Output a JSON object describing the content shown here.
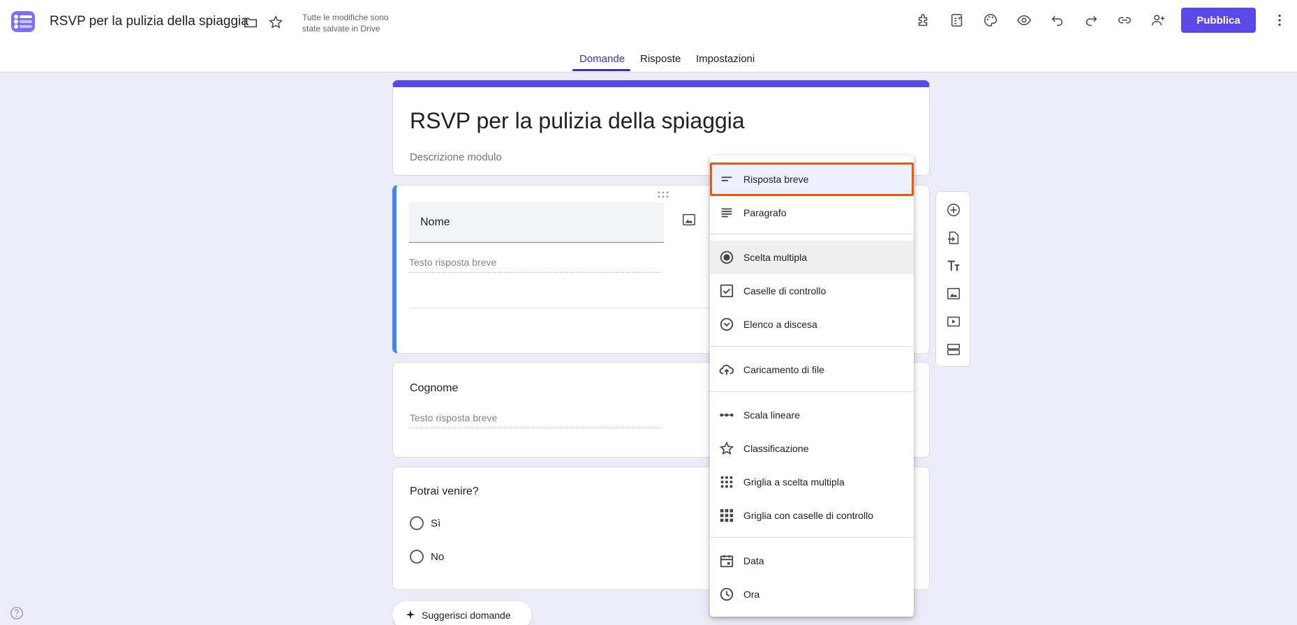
{
  "header": {
    "doc_title": "RSVP per la pulizia della spiaggia",
    "save_status": "Tutte le modifiche sono state salvate in Drive",
    "publish_label": "Pubblica",
    "icons": [
      "folder-icon",
      "star-icon",
      "addon-icon",
      "template-icon",
      "palette-icon",
      "preview-icon",
      "undo-icon",
      "redo-icon",
      "link-icon",
      "add-collaborator-icon",
      "more-icon"
    ]
  },
  "tabs": [
    {
      "label": "Domande",
      "active": true
    },
    {
      "label": "Risposte",
      "active": false
    },
    {
      "label": "Impostazioni",
      "active": false
    }
  ],
  "form": {
    "title": "RSVP per la pulizia della spiaggia",
    "description_placeholder": "Descrizione modulo",
    "questions": [
      {
        "title": "Nome",
        "answer_placeholder": "Testo risposta breve"
      },
      {
        "title": "Cognome",
        "answer_placeholder": "Testo risposta breve"
      },
      {
        "title": "Potrai venire?",
        "options": [
          "Sì",
          "No"
        ]
      }
    ]
  },
  "suggest_button": "Suggerisci domande",
  "menu": {
    "items": [
      {
        "label": "Risposta breve",
        "icon": "short-answer-icon",
        "selected": true
      },
      {
        "label": "Paragrafo",
        "icon": "paragraph-icon"
      },
      {
        "label": "Scelta multipla",
        "icon": "radio-icon",
        "hovered": true
      },
      {
        "label": "Caselle di controllo",
        "icon": "checkbox-icon"
      },
      {
        "label": "Elenco a discesa",
        "icon": "dropdown-icon"
      },
      {
        "label": "Caricamento di file",
        "icon": "cloud-upload-icon"
      },
      {
        "label": "Scala lineare",
        "icon": "linear-scale-icon"
      },
      {
        "label": "Classificazione",
        "icon": "star-rating-icon"
      },
      {
        "label": "Griglia a scelta multipla",
        "icon": "grid-dots-icon"
      },
      {
        "label": "Griglia con caselle di controllo",
        "icon": "grid-checkbox-icon"
      },
      {
        "label": "Data",
        "icon": "calendar-icon"
      },
      {
        "label": "Ora",
        "icon": "clock-icon"
      }
    ]
  },
  "side_toolbar": [
    "add-question-icon",
    "import-questions-icon",
    "add-title-icon",
    "add-image-icon",
    "add-video-icon",
    "add-section-icon"
  ],
  "colors": {
    "accent": "#5b48e8",
    "tab_active": "#3b2cc7",
    "question_active_border": "#4285f4",
    "highlight_border": "#e8590c"
  }
}
